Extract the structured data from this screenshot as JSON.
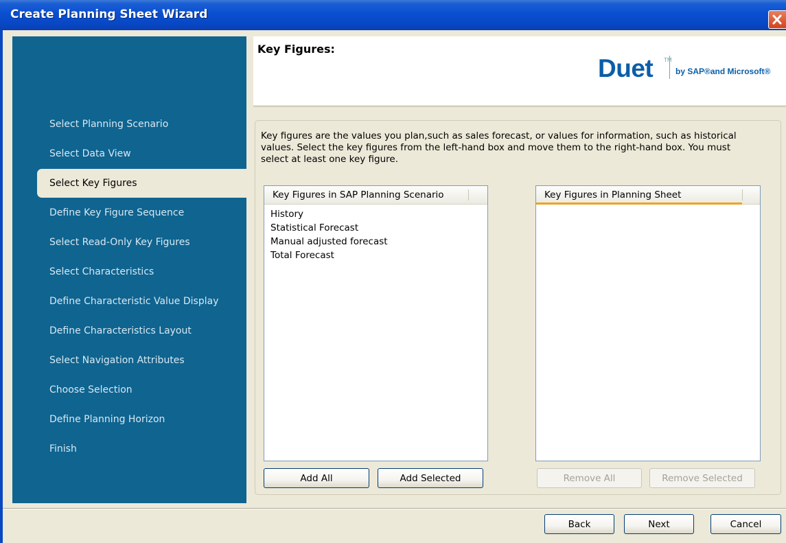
{
  "window": {
    "title": "Create Planning Sheet Wizard"
  },
  "sidebar": {
    "items": [
      {
        "label": "Select Planning Scenario"
      },
      {
        "label": "Select Data View"
      },
      {
        "label": "Select Key Figures"
      },
      {
        "label": "Define Key Figure Sequence"
      },
      {
        "label": "Select Read-Only Key Figures"
      },
      {
        "label": "Select Characteristics"
      },
      {
        "label": "Define Characteristic Value Display"
      },
      {
        "label": "Define Characteristics Layout"
      },
      {
        "label": "Select Navigation Attributes"
      },
      {
        "label": "Choose Selection"
      },
      {
        "label": "Define Planning Horizon"
      },
      {
        "label": "Finish"
      }
    ],
    "active_index": 2
  },
  "header": {
    "title": "Key Figures:",
    "logo_name": "Duet",
    "logo_tagline": "by SAP®and Microsoft®"
  },
  "main": {
    "instructions": "Key figures are the values you plan,such as sales forecast, or values for information, such as historical values. Select the key figures from the left-hand box and move them to the right-hand box. You must select at least one key figure.",
    "left_list": {
      "header": "Key Figures in SAP Planning Scenario",
      "items": [
        "History",
        "Statistical Forecast",
        "Manual adjusted forecast",
        "Total Forecast"
      ]
    },
    "right_list": {
      "header": "Key Figures in Planning Sheet",
      "items": []
    },
    "buttons": {
      "add_all": "Add All",
      "add_selected": "Add Selected",
      "remove_all": "Remove All",
      "remove_selected": "Remove Selected"
    }
  },
  "footer": {
    "back": "Back",
    "next": "Next",
    "cancel": "Cancel"
  },
  "colors": {
    "sidebar_bg": "#0f6490",
    "titlebar": "#0a4fd0",
    "accent_orange": "#f0a31d",
    "brand_blue": "#0b5ea8"
  }
}
